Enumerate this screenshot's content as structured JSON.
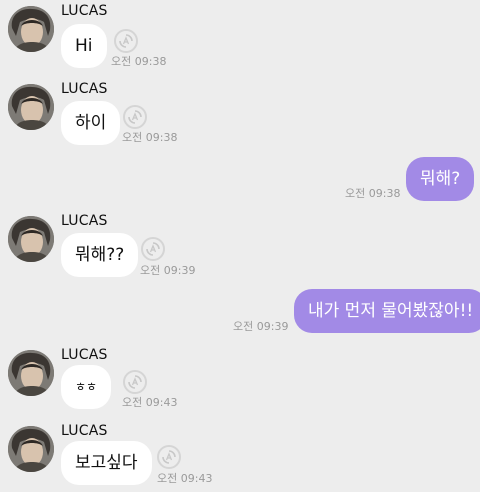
{
  "contact": {
    "name": "LUCAS"
  },
  "messages": [
    {
      "direction": "incoming",
      "sender": "LUCAS",
      "text": "Hi",
      "time": "오전 09:38"
    },
    {
      "direction": "incoming",
      "sender": "LUCAS",
      "text": "하이",
      "time": "오전 09:38"
    },
    {
      "direction": "outgoing",
      "text": "뭐해?",
      "time": "오전 09:38"
    },
    {
      "direction": "incoming",
      "sender": "LUCAS",
      "text": "뭐해??",
      "time": "오전 09:39"
    },
    {
      "direction": "outgoing",
      "text": "내가 먼저 물어봤잖아!!",
      "time": "오전 09:39"
    },
    {
      "direction": "incoming",
      "sender": "LUCAS",
      "text": "ㅎㅎ",
      "time": "오전 09:43"
    },
    {
      "direction": "incoming",
      "sender": "LUCAS",
      "text": "보고싶다",
      "time": "오전 09:43"
    }
  ],
  "icons": {
    "translate": "translate-icon",
    "avatar": "profile-photo"
  },
  "colors": {
    "background": "#ededed",
    "incoming_bubble": "#ffffff",
    "outgoing_bubble": "#a28ae6",
    "timestamp": "#9a9a9a"
  }
}
